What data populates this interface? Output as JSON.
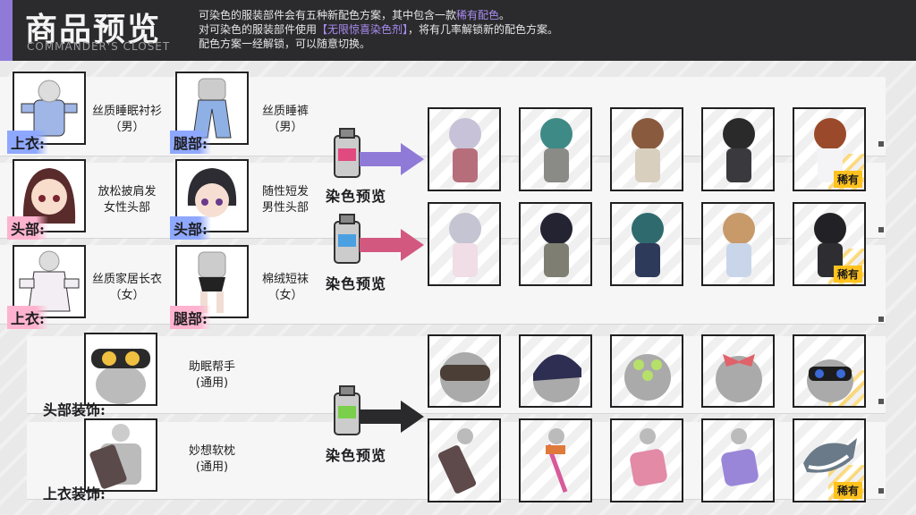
{
  "header": {
    "title": "商品预览",
    "subtitle": "COMMANDER'S CLOSET",
    "note1_prefix": "可染色的服装部件会有五种新配色方案，其中包含一款",
    "note1_highlight": "稀有配色",
    "note1_suffix": "。",
    "note2_prefix": "对可染色的服装部件使用",
    "note2_highlight": "【无限惊喜染色剂】",
    "note2_suffix": "，将有几率解锁新的配色方案。",
    "note3": "配色方案一经解锁，可以随意切换。"
  },
  "colors": {
    "accent": "#8f7ad8",
    "rare": "#ffc21e",
    "tag_blue": "#8fa8ff",
    "tag_pink": "#ffb3cf"
  },
  "items": {
    "shirt_m": {
      "name1": "丝质睡眠衬衫",
      "name2": "（男）",
      "tag": "上衣:"
    },
    "pants_m": {
      "name1": "丝质睡裤",
      "name2": "（男）",
      "tag": "腿部:"
    },
    "hair_f": {
      "name1": "放松披肩发",
      "name2": "女性头部",
      "tag": "头部:"
    },
    "hair_m": {
      "name1": "随性短发",
      "name2": "男性头部",
      "tag": "头部:"
    },
    "coat_f": {
      "name1": "丝质家居长衣",
      "name2": "（女）",
      "tag": "上衣:"
    },
    "socks_f": {
      "name1": "棉绒短袜",
      "name2": "（女）",
      "tag": "腿部:"
    },
    "mask": {
      "name1": "助眠帮手",
      "name2": "(通用)",
      "tag": "头部装饰:"
    },
    "pillow": {
      "name1": "妙想软枕",
      "name2": "(通用)",
      "tag": "上衣装饰:"
    }
  },
  "dye_label": "染色预览",
  "rare_label": "稀有"
}
